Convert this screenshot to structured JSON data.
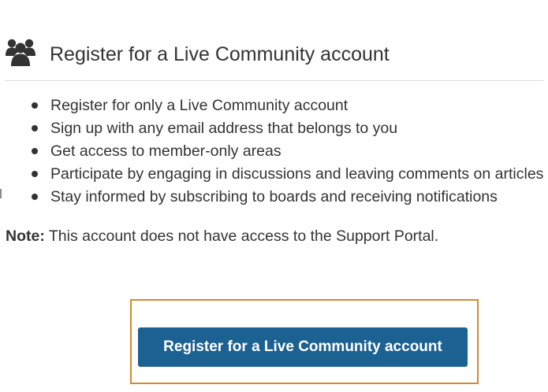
{
  "header": {
    "icon": "users-group-icon",
    "title": "Register for a Live Community account"
  },
  "benefits": [
    {
      "text": "Register for only a Live Community account"
    },
    {
      "text": "Sign up with any email address that belongs to you"
    },
    {
      "text": "Get access to member-only areas"
    },
    {
      "text": "Participate by engaging in discussions and leaving comments on articles"
    },
    {
      "text": "Stay informed by subscribing to boards and receiving notifications"
    }
  ],
  "note": {
    "label": "Note:",
    "text": " This account does not have access to the Support Portal."
  },
  "register_button": {
    "label": "Register for a Live Community account"
  },
  "colors": {
    "text": "#333333",
    "button_background": "#1b6192",
    "button_text": "#ffffff",
    "highlight_border": "#d6892e",
    "divider": "#dcdcdc"
  }
}
